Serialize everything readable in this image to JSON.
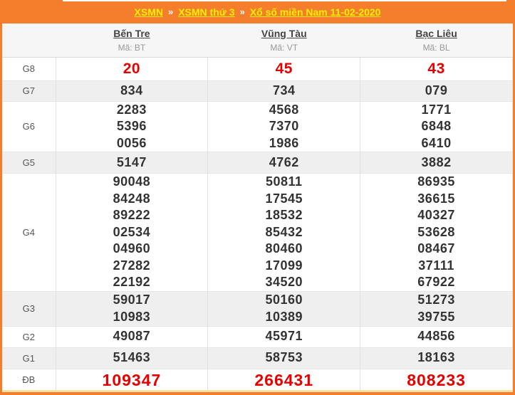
{
  "breadcrumb": {
    "separator": "»",
    "items": [
      {
        "label": "XSMN"
      },
      {
        "label": "XSMN thứ 3"
      },
      {
        "label": "Xổ số miền Nam 11-02-2020"
      }
    ]
  },
  "columns": [
    {
      "name": "Bến Tre",
      "code": "Mã: BT"
    },
    {
      "name": "Vũng Tàu",
      "code": "Mã: VT"
    },
    {
      "name": "Bạc Liêu",
      "code": "Mã: BL"
    }
  ],
  "prizes": [
    {
      "label": "G8",
      "highlight": true,
      "values": [
        [
          "20"
        ],
        [
          "45"
        ],
        [
          "43"
        ]
      ]
    },
    {
      "label": "G7",
      "highlight": false,
      "values": [
        [
          "834"
        ],
        [
          "734"
        ],
        [
          "079"
        ]
      ]
    },
    {
      "label": "G6",
      "highlight": false,
      "values": [
        [
          "2283",
          "5396",
          "0056"
        ],
        [
          "4568",
          "7370",
          "1986"
        ],
        [
          "1771",
          "6848",
          "6410"
        ]
      ]
    },
    {
      "label": "G5",
      "highlight": false,
      "values": [
        [
          "5147"
        ],
        [
          "4762"
        ],
        [
          "3882"
        ]
      ]
    },
    {
      "label": "G4",
      "highlight": false,
      "values": [
        [
          "90048",
          "84248",
          "89222",
          "02534",
          "04960",
          "27282",
          "22192"
        ],
        [
          "50811",
          "17545",
          "18532",
          "85432",
          "80460",
          "17099",
          "34520"
        ],
        [
          "86935",
          "36615",
          "40327",
          "53628",
          "08467",
          "37111",
          "67922"
        ]
      ]
    },
    {
      "label": "G3",
      "highlight": false,
      "values": [
        [
          "59017",
          "10983"
        ],
        [
          "50160",
          "10389"
        ],
        [
          "51273",
          "39755"
        ]
      ]
    },
    {
      "label": "G2",
      "highlight": false,
      "values": [
        [
          "49087"
        ],
        [
          "45971"
        ],
        [
          "44856"
        ]
      ]
    },
    {
      "label": "G1",
      "highlight": false,
      "values": [
        [
          "51463"
        ],
        [
          "58753"
        ],
        [
          "18163"
        ]
      ]
    },
    {
      "label": "ĐB",
      "highlight": true,
      "values": [
        [
          "109347"
        ],
        [
          "266431"
        ],
        [
          "808233"
        ]
      ]
    }
  ],
  "colors": {
    "frame_orange": "#F57E2C",
    "link_yellow": "#FFF000",
    "highlight_red": "#E60000",
    "stripe_gray": "#EFEFEF",
    "accent_cream": "#F7E2A6"
  }
}
